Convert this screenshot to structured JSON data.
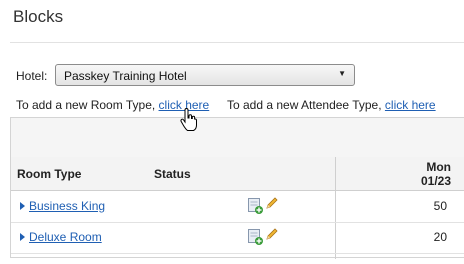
{
  "page": {
    "title": "Blocks"
  },
  "hotel": {
    "label": "Hotel:",
    "selected": "Passkey Training Hotel"
  },
  "info": {
    "room_type_text": "To add a new Room Type,",
    "room_type_link": "click here",
    "attendee_type_text": "To add a new Attendee Type,",
    "attendee_type_link": "click here"
  },
  "grid": {
    "headers": {
      "room_type": "Room Type",
      "status": "Status",
      "day_name": "Mon",
      "day_date": "01/23"
    },
    "rows": [
      {
        "room_type": "Business King",
        "value": "50"
      },
      {
        "room_type": "Deluxe Room",
        "value": "20"
      }
    ]
  },
  "icons": {
    "add_status": "add-document-icon",
    "edit": "pencil-icon",
    "expander": "triangle-right-icon",
    "cursor": "hand-pointer-icon"
  },
  "colors": {
    "link": "#1f5fb3",
    "header_bg": "#f3f3f3"
  }
}
